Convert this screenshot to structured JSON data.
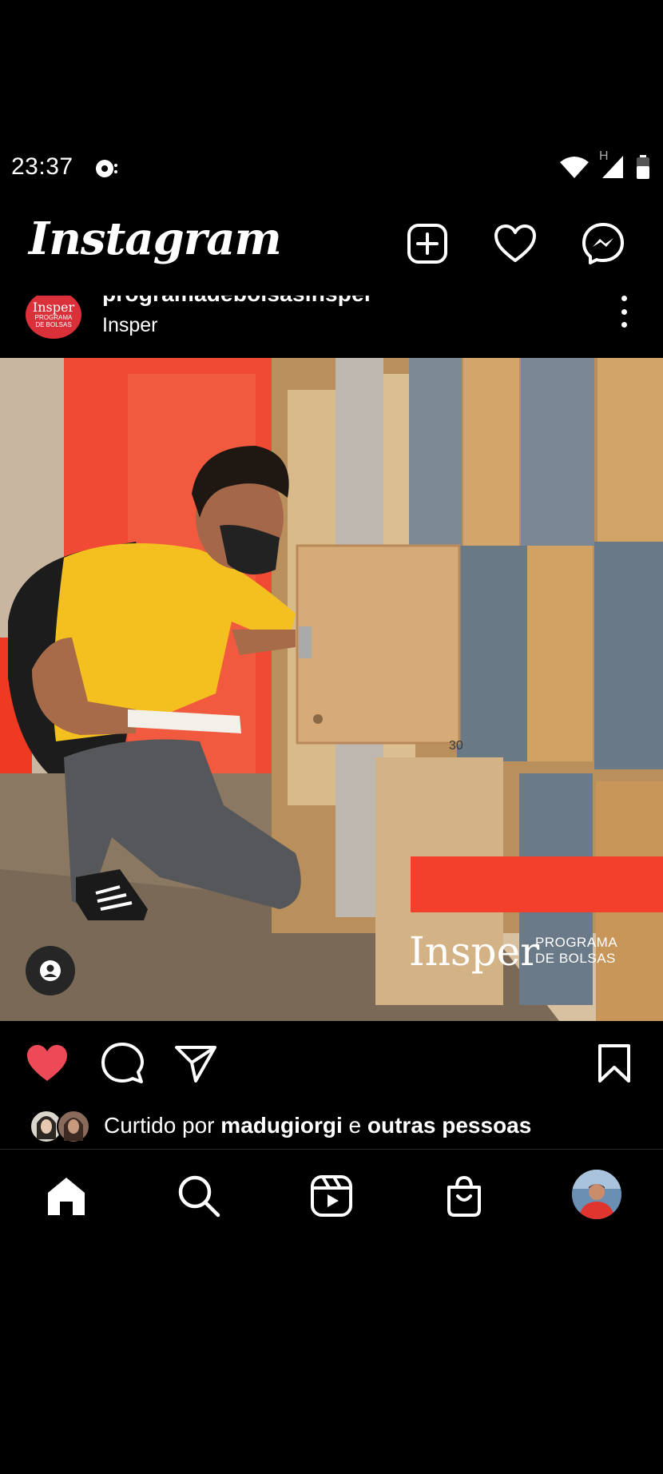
{
  "status_bar": {
    "time": "23:37",
    "icons": [
      "notification-icon",
      "wifi-icon",
      "signal-icon",
      "battery-icon"
    ],
    "network_label": "H"
  },
  "header": {
    "title": "Instagram",
    "actions": [
      "new-post-icon",
      "heart-icon",
      "messenger-icon"
    ]
  },
  "post": {
    "username": "programadebolsasinsper",
    "subtitle": "Insper",
    "avatar": {
      "line1": "Insper",
      "line2": "PROGRAMA",
      "line3": "DE BOLSAS"
    },
    "image": {
      "brand_word": "Insper",
      "brand_tag_line1": "PROGRAMA",
      "brand_tag_line2": "DE BOLSAS",
      "locker_number": "30"
    },
    "liked": true,
    "likes": {
      "prefix": "Curtido por ",
      "user": "madugiorgi",
      "middle": " e ",
      "others": "outras pessoas"
    }
  },
  "colors": {
    "like_red": "#ed4956",
    "brand_red": "#f2402c",
    "background": "#000000"
  },
  "bottom_nav": [
    "home-icon",
    "search-icon",
    "reels-icon",
    "shop-icon",
    "profile-avatar"
  ]
}
